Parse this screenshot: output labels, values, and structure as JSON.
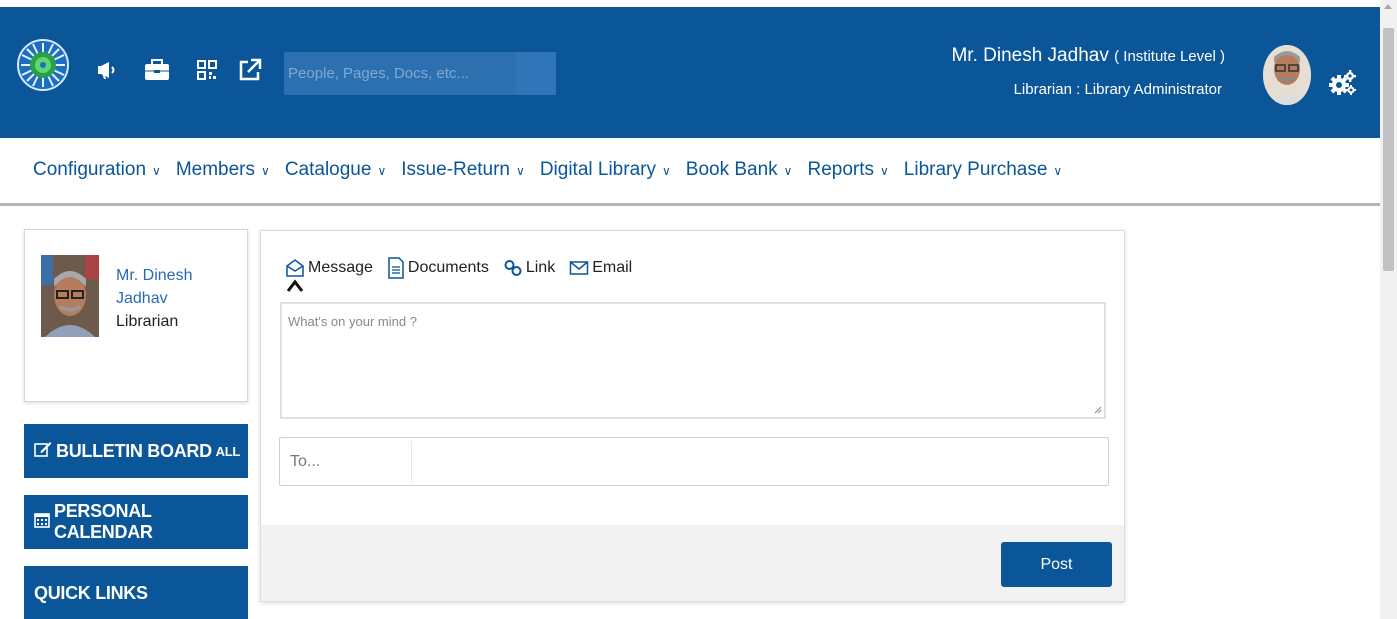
{
  "header": {
    "search_placeholder": "People, Pages, Docs, etc...",
    "user_name": "Mr. Dinesh Jadhav",
    "user_level": "( Institute Level )",
    "user_role": "Librarian : Library Administrator",
    "icons": [
      "logo",
      "megaphone-icon",
      "briefcase-icon",
      "qr-code-icon",
      "external-link-icon",
      "search-icon",
      "gears-icon"
    ]
  },
  "nav": {
    "items": [
      {
        "label": "Configuration"
      },
      {
        "label": "Members"
      },
      {
        "label": "Catalogue"
      },
      {
        "label": "Issue-Return"
      },
      {
        "label": "Digital Library"
      },
      {
        "label": "Book Bank"
      },
      {
        "label": "Reports"
      },
      {
        "label": "Library Purchase"
      }
    ]
  },
  "profile": {
    "name": "Mr. Dinesh Jadhav",
    "role": "Librarian"
  },
  "sidebar": {
    "bulletin_board": "BULLETIN BOARD",
    "bulletin_all": "ALL",
    "personal_calendar": "PERSONAL CALENDAR",
    "quick_links": "QUICK LINKS"
  },
  "post": {
    "tabs": [
      {
        "label": "Message",
        "icon": "message-icon"
      },
      {
        "label": "Documents",
        "icon": "document-icon"
      },
      {
        "label": "Link",
        "icon": "link-icon"
      },
      {
        "label": "Email",
        "icon": "email-icon"
      }
    ],
    "selected_tab": "Message",
    "message_placeholder": "What's on your mind ?",
    "to_placeholder": "To...",
    "post_button": "Post"
  },
  "colors": {
    "brand": "#0b5599",
    "search_bg": "#2d70b0",
    "footer_bg": "#f2f2f2"
  }
}
